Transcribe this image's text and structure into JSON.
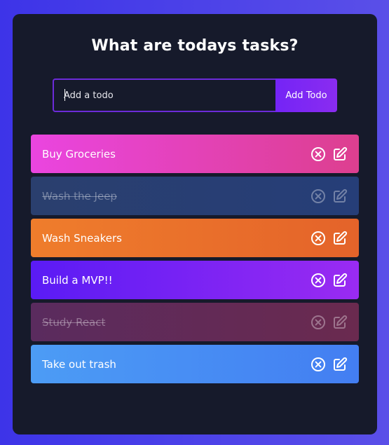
{
  "header": {
    "title": "What are todays tasks?"
  },
  "form": {
    "placeholder": "Add a todo",
    "value": "",
    "button_label": "Add Todo"
  },
  "todos": [
    {
      "text": "Buy Groceries",
      "completed": false,
      "gradient": [
        "#ea45e0",
        "#dd3f8f"
      ]
    },
    {
      "text": "Wash the Jeep",
      "completed": true,
      "gradient": [
        "#2a3f6e",
        "#263e78"
      ]
    },
    {
      "text": "Wash Sneakers",
      "completed": false,
      "gradient": [
        "#ef7d2c",
        "#e4632a"
      ]
    },
    {
      "text": "Build a MVP!!",
      "completed": false,
      "gradient": [
        "#5a1bf5",
        "#9a2bf2"
      ]
    },
    {
      "text": "Study React",
      "completed": true,
      "gradient": [
        "#5a2b5e",
        "#6a2a4f"
      ]
    },
    {
      "text": "Take out trash",
      "completed": false,
      "gradient": [
        "#4c9cf5",
        "#437ef2"
      ]
    }
  ],
  "icons": {
    "delete": "close-circle-icon",
    "edit": "edit-icon"
  }
}
